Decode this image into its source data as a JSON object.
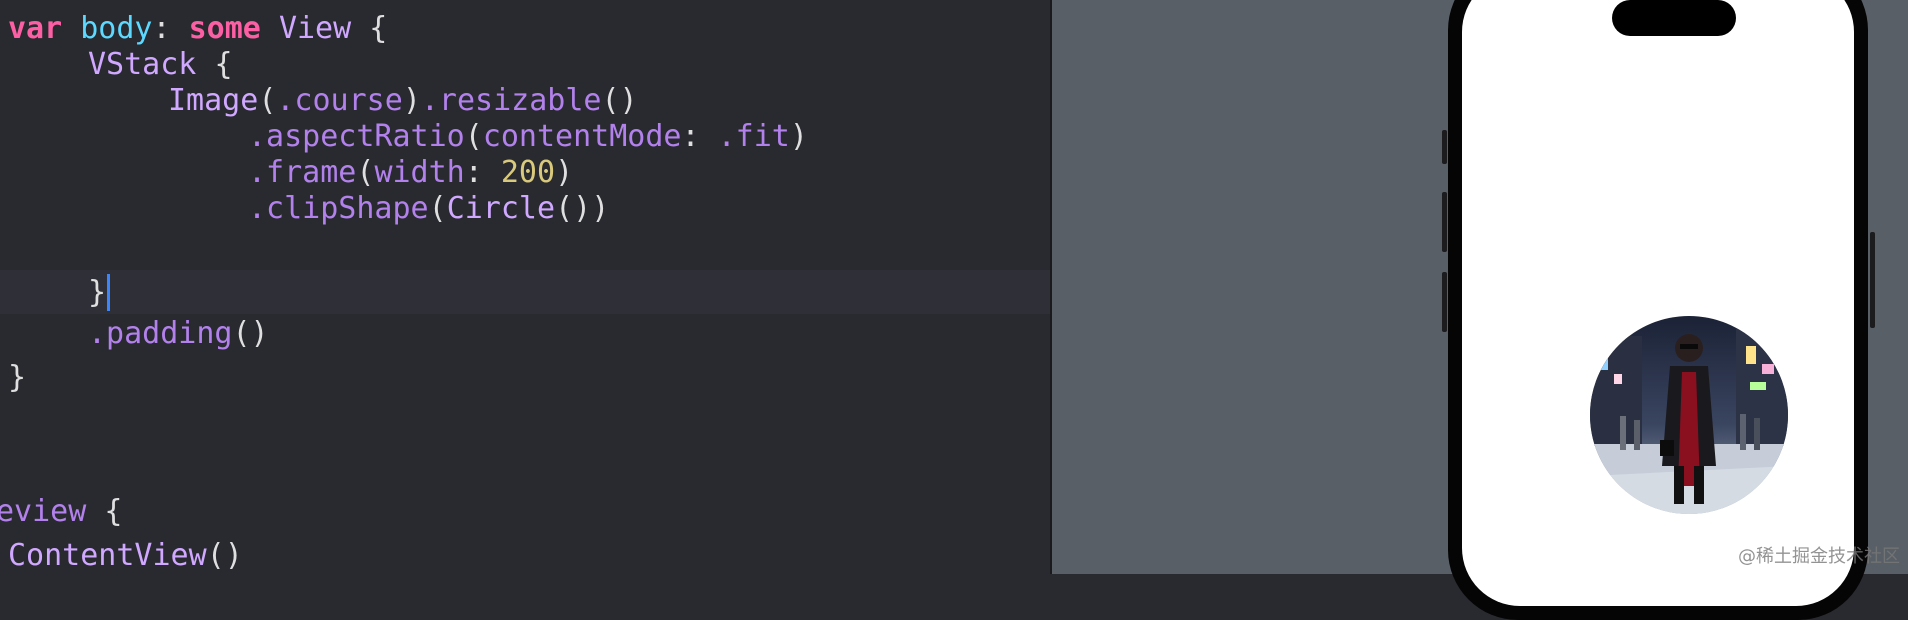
{
  "editor": {
    "line1": {
      "keyword1": "var",
      "name": "body",
      "colon": ":",
      "keyword2": "some",
      "type": "View",
      "brace": "{"
    },
    "line2": {
      "type": "VStack",
      "brace": "{"
    },
    "line3": {
      "type": "Image",
      "paren_open": "(",
      "member": ".course",
      "paren_close": ")",
      "method": ".resizable",
      "call": "()"
    },
    "line4": {
      "method": ".aspectRatio",
      "paren_open": "(",
      "label": "contentMode",
      "colon": ":",
      "value": ".fit",
      "paren_close": ")"
    },
    "line5": {
      "method": ".frame",
      "paren_open": "(",
      "label": "width",
      "colon": ":",
      "number": "200",
      "paren_close": ")"
    },
    "line6": {
      "method": ".clipShape",
      "paren_open": "(",
      "type": "Circle",
      "call": "()",
      "paren_close": ")"
    },
    "line7": {
      "brace": "}"
    },
    "line8": {
      "method": ".padding",
      "call": "()"
    },
    "line9": {
      "brace": "}"
    },
    "line11": {
      "partial": "eview",
      "brace": "{"
    },
    "line12": {
      "type": "ContentView",
      "call": "()"
    }
  },
  "colors": {
    "editor_background": "#292a30",
    "keyword": "#fc5fa3",
    "method": "#b281eb",
    "number": "#d9c97c",
    "canvas_background": "#595f67"
  },
  "preview": {
    "image_description": "circular-photo-woman-city-street-night"
  },
  "watermark": "@稀土掘金技术社区"
}
